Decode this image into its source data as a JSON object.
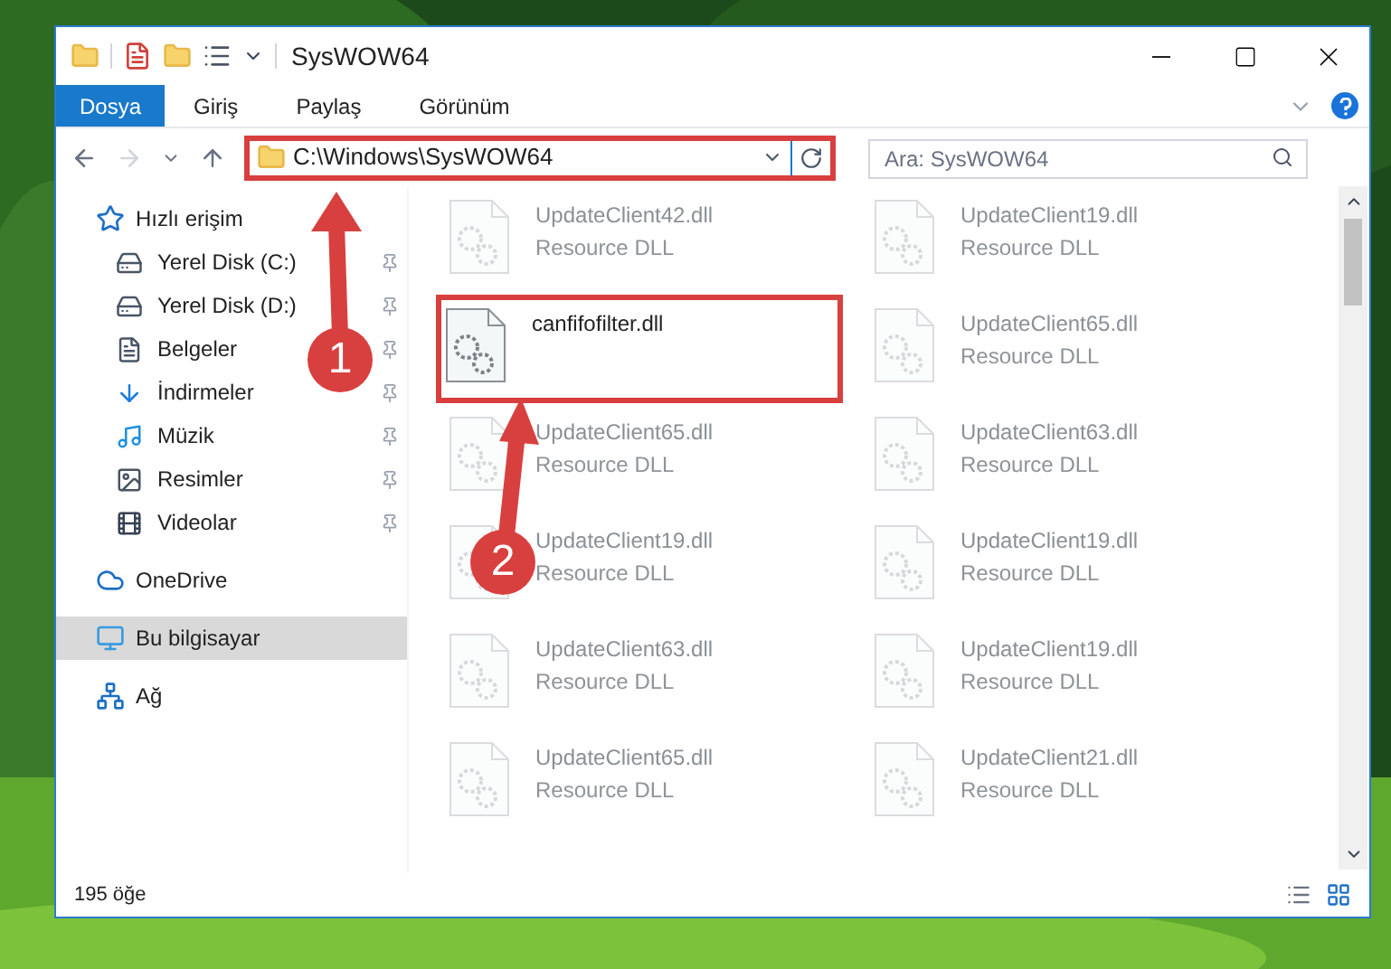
{
  "window": {
    "title": "SysWOW64"
  },
  "ribbon_tabs": [
    {
      "label": "Dosya",
      "selected": true
    },
    {
      "label": "Giriş",
      "selected": false
    },
    {
      "label": "Paylaş",
      "selected": false
    },
    {
      "label": "Görünüm",
      "selected": false
    }
  ],
  "address_bar": {
    "value": "C:\\Windows\\SysWOW64",
    "highlighted": true
  },
  "search": {
    "placeholder": "Ara: SysWOW64"
  },
  "sidebar": {
    "items": [
      {
        "label": "Hızlı erişim",
        "selected": false,
        "children": [
          {
            "label": "Yerel Disk (C:)",
            "pinned": true
          },
          {
            "label": "Yerel Disk (D:)",
            "pinned": true
          },
          {
            "label": "Belgeler",
            "pinned": true
          },
          {
            "label": "İndirmeler",
            "pinned": true
          },
          {
            "label": "Müzik",
            "pinned": true
          },
          {
            "label": "Resimler",
            "pinned": true
          },
          {
            "label": "Videolar",
            "pinned": true
          }
        ]
      },
      {
        "label": "OneDrive",
        "selected": false
      },
      {
        "label": "Bu bilgisayar",
        "selected": true
      },
      {
        "label": "Ağ",
        "selected": false
      }
    ]
  },
  "files": [
    {
      "name": "UpdateClient42.dll",
      "type": "Resource DLL",
      "blurred": true,
      "highlighted": false
    },
    {
      "name": "UpdateClient19.dll",
      "type": "Resource DLL",
      "blurred": true,
      "highlighted": false
    },
    {
      "name": "canfifofilter.dll",
      "blurred": false,
      "highlighted": true
    },
    {
      "name": "UpdateClient65.dll",
      "type": "Resource DLL",
      "blurred": true,
      "highlighted": false
    },
    {
      "name": "UpdateClient65.dll",
      "type": "Resource DLL",
      "blurred": true,
      "highlighted": false
    },
    {
      "name": "UpdateClient63.dll",
      "type": "Resource DLL",
      "blurred": true,
      "highlighted": false
    },
    {
      "name": "UpdateClient19.dll",
      "type": "Resource DLL",
      "blurred": true,
      "highlighted": false
    },
    {
      "name": "UpdateClient19.dll",
      "type": "Resource DLL",
      "blurred": true,
      "highlighted": false
    },
    {
      "name": "UpdateClient63.dll",
      "type": "Resource DLL",
      "blurred": true,
      "highlighted": false
    },
    {
      "name": "UpdateClient19.dll",
      "type": "Resource DLL",
      "blurred": true,
      "highlighted": false
    },
    {
      "name": "UpdateClient65.dll",
      "type": "Resource DLL",
      "blurred": true,
      "highlighted": false
    },
    {
      "name": "UpdateClient21.dll",
      "type": "Resource DLL",
      "blurred": true,
      "highlighted": false
    }
  ],
  "status_bar": {
    "count": "195 öğe"
  },
  "step_markers": [
    {
      "label": "1"
    },
    {
      "label": "2"
    }
  ]
}
